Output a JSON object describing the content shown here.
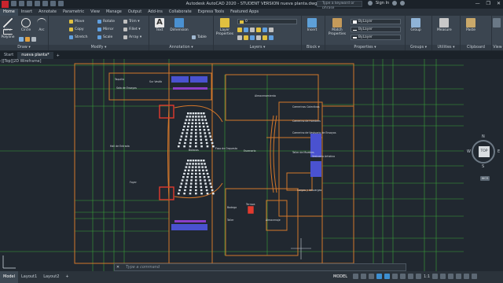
{
  "titlebar": {
    "title": "Autodesk AutoCAD 2020 - STUDENT VERSION    nueva planta.dwg",
    "search_placeholder": "Type a keyword or phrase",
    "sign_in": "Sign In",
    "minimize": "—",
    "restore": "❐",
    "close": "✕"
  },
  "menu_tabs": [
    "Home",
    "Insert",
    "Annotate",
    "Parametric",
    "View",
    "Manage",
    "Output",
    "Add-ins",
    "Collaborate",
    "Express Tools",
    "Featured Apps"
  ],
  "ribbon": {
    "draw": {
      "title": "Draw ▾",
      "line": "Line",
      "polyline": "Polyline",
      "circle": "Circle",
      "arc": "Arc"
    },
    "modify": {
      "title": "Modify ▾",
      "move": "Move",
      "rotate": "Rotate",
      "trim": "Trim ▾",
      "copy": "Copy",
      "mirror": "Mirror",
      "fillet": "Fillet ▾",
      "stretch": "Stretch",
      "scale": "Scale",
      "array": "Array ▾"
    },
    "annotation": {
      "title": "Annotation ▾",
      "text": "Text",
      "dimension": "Dimension",
      "table": "Table"
    },
    "layers": {
      "title": "Layers ▾",
      "layer_properties": "Layer Properties",
      "current_layer": "0"
    },
    "block": {
      "title": "Block ▾",
      "insert": "Insert"
    },
    "properties": {
      "title": "Properties ▾",
      "match": "Match Properties",
      "color": "ByLayer",
      "linetype": "ByLayer",
      "lineweight": "ByLayer"
    },
    "groups": {
      "title": "Groups ▾",
      "group": "Group"
    },
    "utilities": {
      "title": "Utilities ▾",
      "measure": "Measure"
    },
    "clipboard": {
      "title": "Clipboard",
      "paste": "Paste"
    },
    "view": {
      "title": "View"
    }
  },
  "file_tabs": {
    "start": "Start",
    "active": "nueva planta*",
    "plus": "+"
  },
  "canvas": {
    "view_label": "-][Top][2D Wireframe]",
    "room_labels": [
      {
        "text": "Taquilla"
      },
      {
        "text": "Sur Vestib"
      },
      {
        "text": "Sala de Ensayos"
      },
      {
        "text": "Camerinos Colectivos"
      },
      {
        "text": "Camerino de Hombres"
      },
      {
        "text": "Camerino de Vestuario de Ensayos"
      },
      {
        "text": "Taller de Muebles"
      },
      {
        "text": "Vestuario Artistico"
      },
      {
        "text": "Hall de Entrada"
      },
      {
        "text": "Foyer"
      },
      {
        "text": "Butacas"
      },
      {
        "text": "Foso de Orquesta"
      },
      {
        "text": "Escenario"
      },
      {
        "text": "Almacenamiento"
      },
      {
        "text": "Cargas y descargas"
      },
      {
        "text": "Bodega"
      },
      {
        "text": "Taller"
      },
      {
        "text": "Terraza"
      },
      {
        "text": "Almacenaje"
      }
    ]
  },
  "viewcube": {
    "n": "N",
    "s": "S",
    "w": "W",
    "e": "E",
    "top": "TOP",
    "wcs": "WCS"
  },
  "commandline": {
    "close": "✕",
    "placeholder": "Type a command"
  },
  "statusbar": {
    "layouts": [
      "Model",
      "Layout1",
      "Layout2"
    ],
    "add": "+",
    "model": "MODEL",
    "scale": "1:1"
  }
}
